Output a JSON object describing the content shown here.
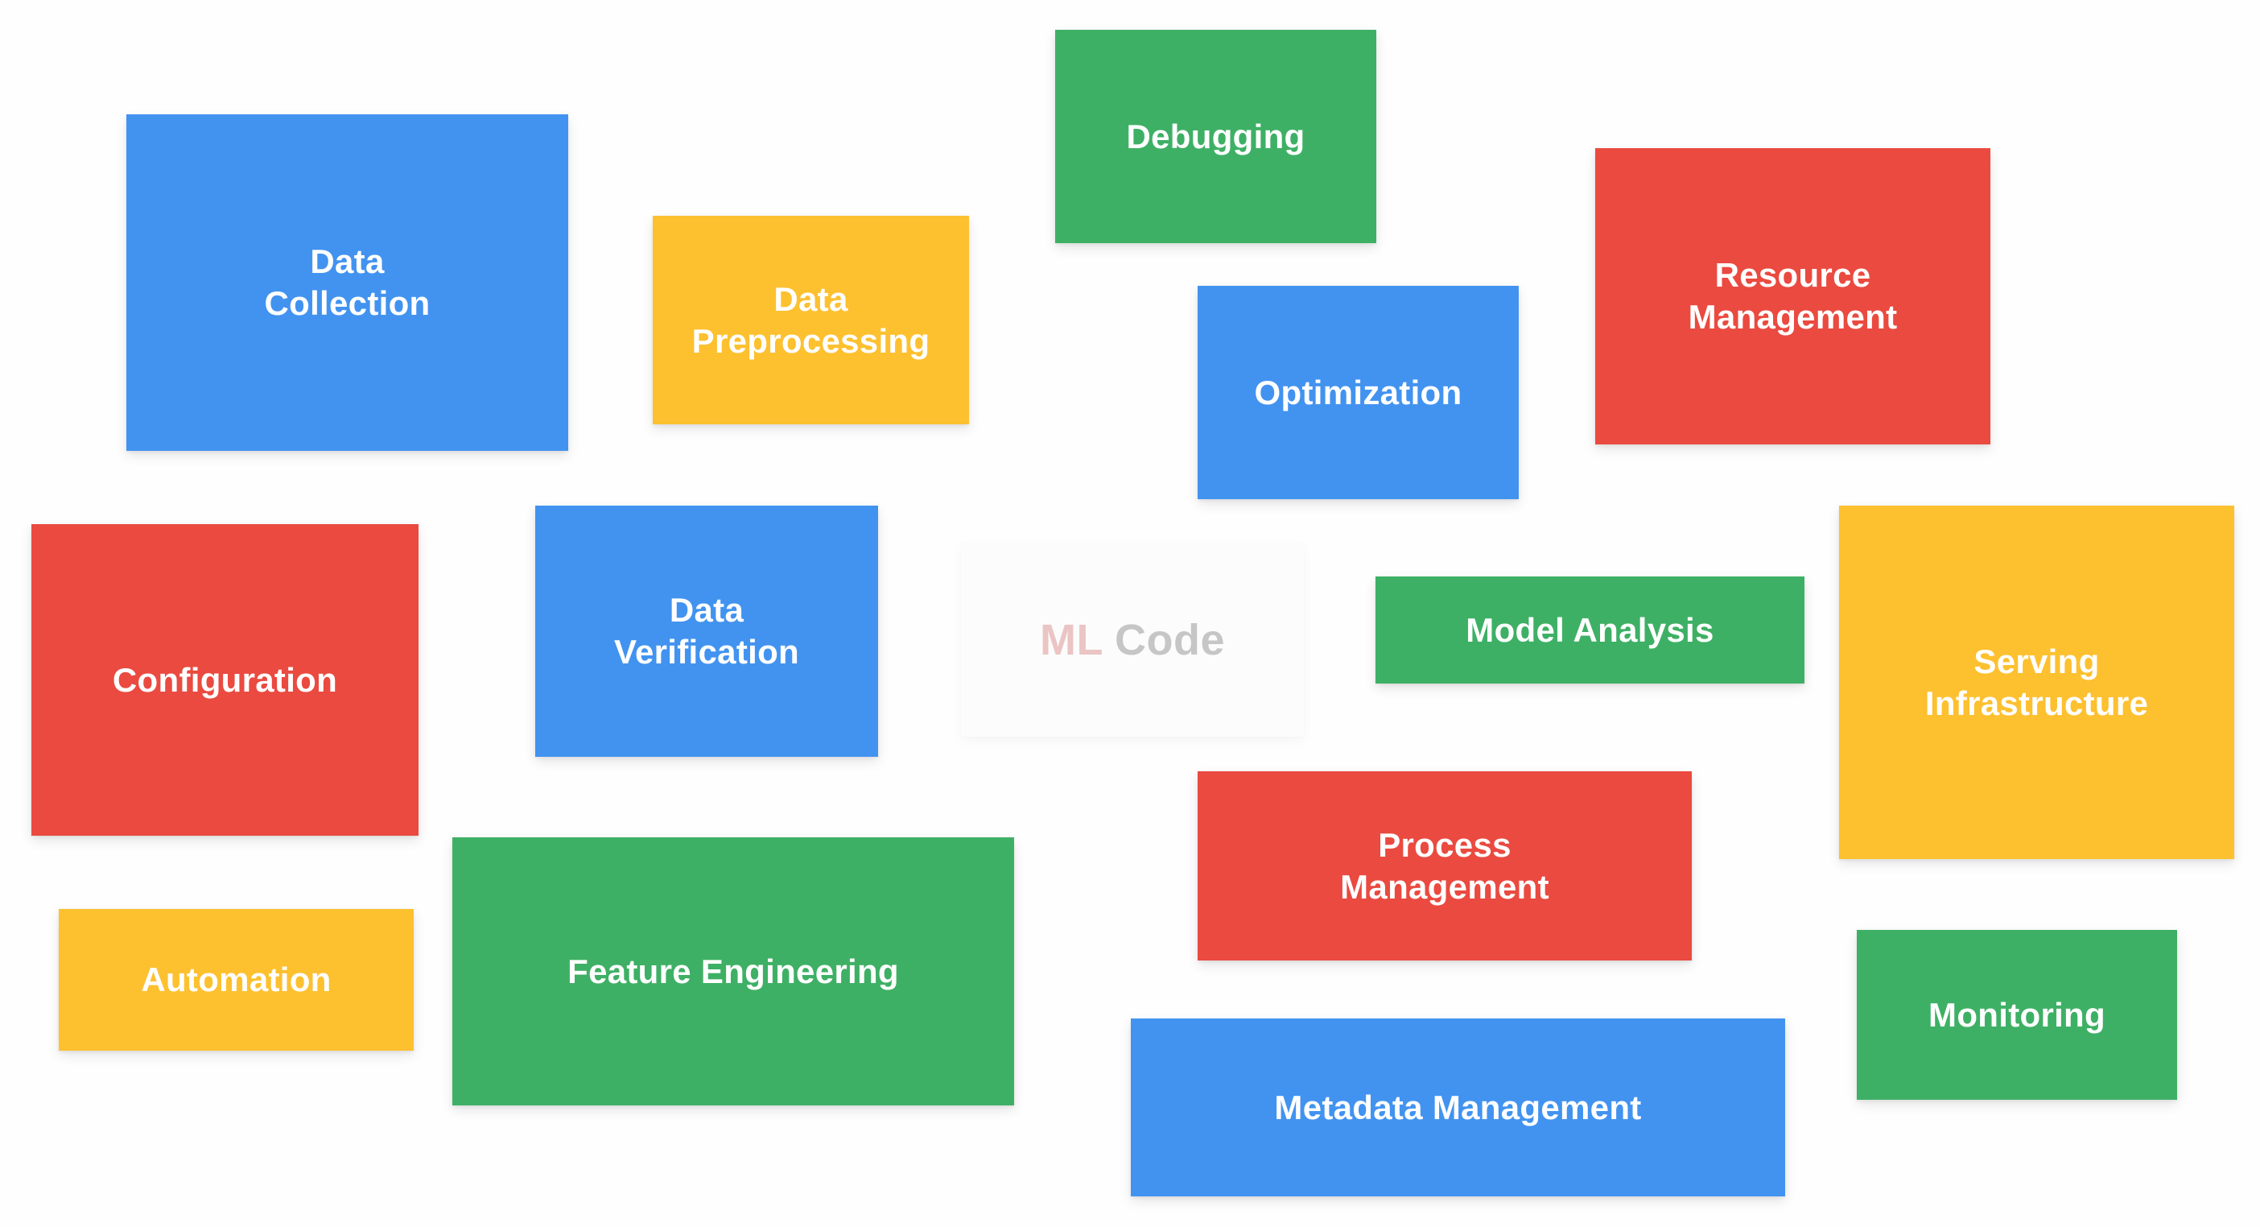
{
  "center": {
    "prefix": "ML",
    "suffix": "Code",
    "prefix_color": "#EBC4C4",
    "suffix_color": "#C6C6C6"
  },
  "palette": {
    "blue": "#4293F0",
    "green": "#3EB065",
    "red": "#EA4A40",
    "yellow": "#FDC02F"
  },
  "tiles": [
    {
      "id": "data-collection",
      "label": "Data\nCollection",
      "color": "blue"
    },
    {
      "id": "data-preprocessing",
      "label": "Data\nPreprocessing",
      "color": "yellow"
    },
    {
      "id": "debugging",
      "label": "Debugging",
      "color": "green"
    },
    {
      "id": "optimization",
      "label": "Optimization",
      "color": "blue"
    },
    {
      "id": "resource-management",
      "label": "Resource\nManagement",
      "color": "red"
    },
    {
      "id": "configuration",
      "label": "Configuration",
      "color": "red"
    },
    {
      "id": "data-verification",
      "label": "Data\nVerification",
      "color": "blue"
    },
    {
      "id": "model-analysis",
      "label": "Model Analysis",
      "color": "green"
    },
    {
      "id": "serving-infrastructure",
      "label": "Serving\nInfrastructure",
      "color": "yellow"
    },
    {
      "id": "automation",
      "label": "Automation",
      "color": "yellow"
    },
    {
      "id": "feature-engineering",
      "label": "Feature Engineering",
      "color": "green"
    },
    {
      "id": "process-management",
      "label": "Process\nManagement",
      "color": "red"
    },
    {
      "id": "monitoring",
      "label": "Monitoring",
      "color": "green"
    },
    {
      "id": "metadata-management",
      "label": "Metadata Management",
      "color": "blue"
    }
  ]
}
